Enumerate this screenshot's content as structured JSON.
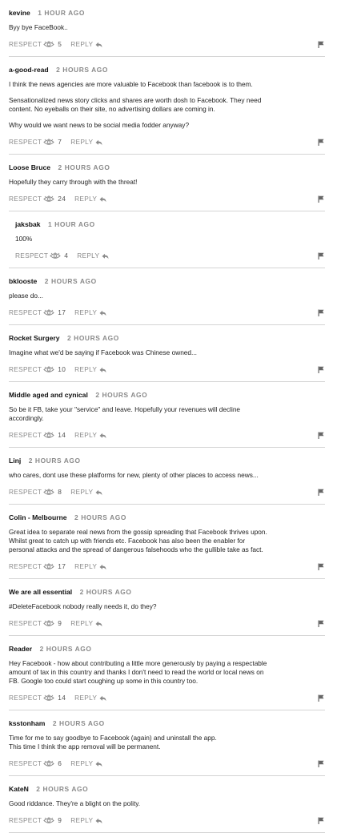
{
  "labels": {
    "respect": "RESPECT",
    "reply": "REPLY"
  },
  "icons": {
    "respect": "eye-icon",
    "reply": "reply-arrow-icon",
    "flag": "flag-icon"
  },
  "comments": [
    {
      "author": "kevine",
      "time": "1 HOUR AGO",
      "paragraphs": [
        "Byy bye FaceBook.."
      ],
      "respect": "5",
      "reply": false
    },
    {
      "author": "a-good-read",
      "time": "2 HOURS AGO",
      "paragraphs": [
        "I think the news agencies are more valuable to Facebook than facebook is to them.",
        "Sensationalized news story clicks and shares are worth dosh to Facebook. They need content. No eyeballs on their site, no advertising dollars are coming in.",
        "Why would we want news to be social media fodder anyway?"
      ],
      "respect": "7",
      "reply": false
    },
    {
      "author": "Loose Bruce",
      "time": "2 HOURS AGO",
      "paragraphs": [
        "Hopefully they carry through with the threat!"
      ],
      "respect": "24",
      "reply": false
    },
    {
      "author": "jaksbak",
      "time": "1 HOUR AGO",
      "paragraphs": [
        "100%"
      ],
      "respect": "4",
      "reply": true
    },
    {
      "author": "bklooste",
      "time": "2 HOURS AGO",
      "paragraphs": [
        "please do..."
      ],
      "respect": "17",
      "reply": false
    },
    {
      "author": "Rocket Surgery",
      "time": "2 HOURS AGO",
      "paragraphs": [
        "Imagine what we'd be saying if Facebook was Chinese owned..."
      ],
      "respect": "10",
      "reply": false
    },
    {
      "author": "Middle aged and cynical",
      "time": "2 HOURS AGO",
      "paragraphs": [
        "So be it FB, take your \"service\" and leave. Hopefully your revenues will decline accordingly."
      ],
      "respect": "14",
      "reply": false
    },
    {
      "author": "Linj",
      "time": "2 HOURS AGO",
      "paragraphs": [
        "who cares, dont use these platforms for new, plenty of other places to access news..."
      ],
      "respect": "8",
      "reply": false
    },
    {
      "author": "Colin - Melbourne",
      "time": "2 HOURS AGO",
      "paragraphs": [
        "Great idea to separate real news from the gossip spreading that Facebook thrives upon. Whilst great to catch up with friends etc. Facebook has also been the enabler for personal attacks and the spread of dangerous falsehoods who the gullible take as fact."
      ],
      "respect": "17",
      "reply": false
    },
    {
      "author": "We are all essential",
      "time": "2 HOURS AGO",
      "paragraphs": [
        "#DeleteFacebook nobody really needs it, do they?"
      ],
      "respect": "9",
      "reply": false
    },
    {
      "author": "Reader",
      "time": "2 HOURS AGO",
      "paragraphs": [
        "Hey Facebook - how about contributing a little more generously by paying a respectable amount of tax in this country and thanks I don't need to read the world or local news on FB. Google too could start coughing up some in this country too."
      ],
      "respect": "14",
      "reply": false
    },
    {
      "author": "ksstonham",
      "time": "2 HOURS AGO",
      "paragraphs": [
        "Time for me to say goodbye to Facebook (again) and uninstall the app.\nThis time I think the app removal will be permanent."
      ],
      "respect": "6",
      "reply": false
    },
    {
      "author": "KateN",
      "time": "2 HOURS AGO",
      "paragraphs": [
        "Good riddance. They're a blight on the polity."
      ],
      "respect": "9",
      "reply": false
    }
  ]
}
